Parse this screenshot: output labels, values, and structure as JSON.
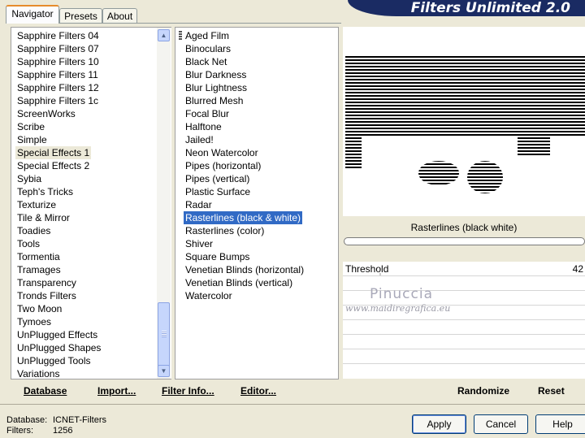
{
  "tabs": [
    {
      "label": "Navigator",
      "active": true
    },
    {
      "label": "Presets",
      "active": false
    },
    {
      "label": "About",
      "active": false
    }
  ],
  "banner": {
    "title": "Filters Unlimited 2.0"
  },
  "categories": {
    "items": [
      "Sapphire Filters 04",
      "Sapphire Filters 07",
      "Sapphire Filters 10",
      "Sapphire Filters 11",
      "Sapphire Filters 12",
      "Sapphire Filters 1c",
      "ScreenWorks",
      "Scribe",
      "Simple",
      "Special Effects 1",
      "Special Effects 2",
      "Sybia",
      "Teph's Tricks",
      "Texturize",
      "Tile & Mirror",
      "Toadies",
      "Tools",
      "Tormentia",
      "Tramages",
      "Transparency",
      "Tronds Filters",
      "Two Moon",
      "Tymoes",
      "UnPlugged Effects",
      "UnPlugged Shapes",
      "UnPlugged Tools",
      "Variations"
    ],
    "selected": "Special Effects 1"
  },
  "filters": {
    "items": [
      "Aged Film",
      "Binoculars",
      "Black Net",
      "Blur Darkness",
      "Blur Lightness",
      "Blurred Mesh",
      "Focal Blur",
      "Halftone",
      "Jailed!",
      "Neon Watercolor",
      "Pipes (horizontal)",
      "Pipes (vertical)",
      "Plastic Surface",
      "Radar",
      "Rasterlines (black & white)",
      "Rasterlines (color)",
      "Shiver",
      "Square Bumps",
      "Venetian Blinds (horizontal)",
      "Venetian Blinds (vertical)",
      "Watercolor"
    ],
    "selected": "Rasterlines (black & white)"
  },
  "preview": {
    "filter_title": "Rasterlines (black  white)",
    "watermark_name": "Pinuccia",
    "watermark_url": "www.maidiregrafica.eu"
  },
  "params": {
    "threshold_label": "Threshold",
    "threshold_value": "42"
  },
  "commands": {
    "database": "Database",
    "import": "Import...",
    "filter_info": "Filter Info...",
    "editor": "Editor...",
    "randomize": "Randomize",
    "reset": "Reset"
  },
  "buttons": {
    "apply": "Apply",
    "cancel": "Cancel",
    "help": "Help"
  },
  "status": {
    "database_label": "Database:",
    "database_value": "ICNET-Filters",
    "filters_label": "Filters:",
    "filters_value": "1256"
  },
  "icons": {
    "scroll_up": "arrow-up-icon",
    "scroll_down": "arrow-down-icon"
  }
}
